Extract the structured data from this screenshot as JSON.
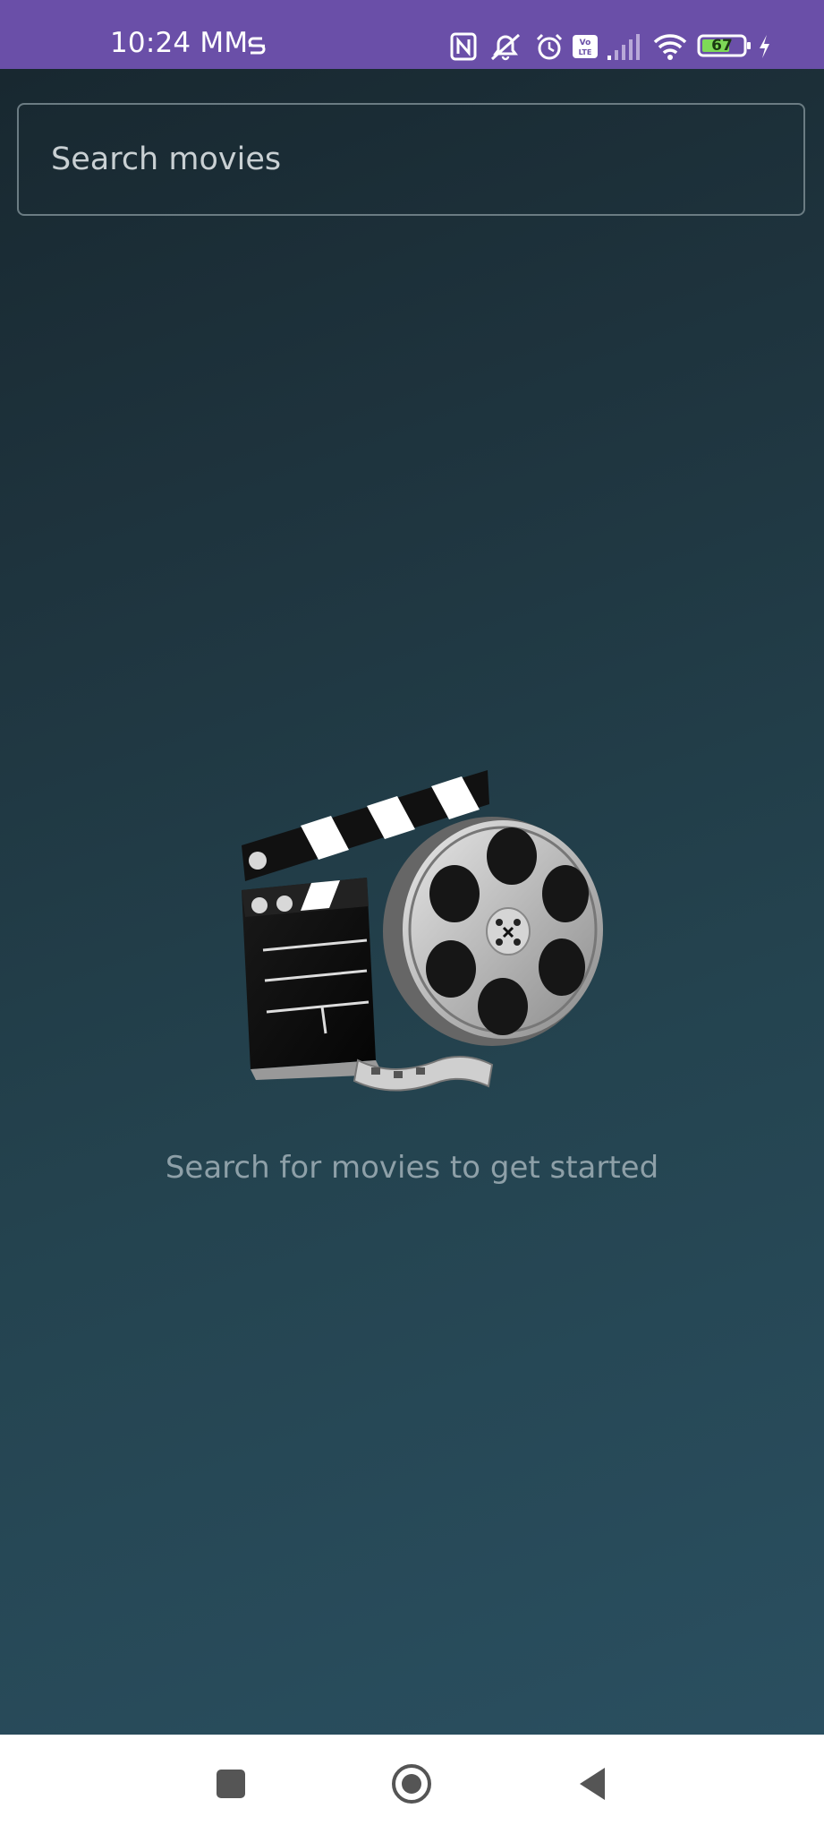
{
  "status_bar": {
    "time": "10:24 MM",
    "battery_level": "67",
    "background_color": "#6a4fa8",
    "icons": [
      "notification-s-icon",
      "nfc-icon",
      "mute-icon",
      "alarm-icon",
      "volte-icon",
      "signal-icon",
      "wifi-icon",
      "battery-icon",
      "charging-icon"
    ]
  },
  "search": {
    "placeholder": "Search movies",
    "value": ""
  },
  "empty_state": {
    "illustration": "film-clapper-and-reel-icon",
    "message": "Search for movies to get started"
  },
  "nav_bar": {
    "buttons": [
      "recents-square-icon",
      "home-circle-icon",
      "back-triangle-icon"
    ]
  }
}
